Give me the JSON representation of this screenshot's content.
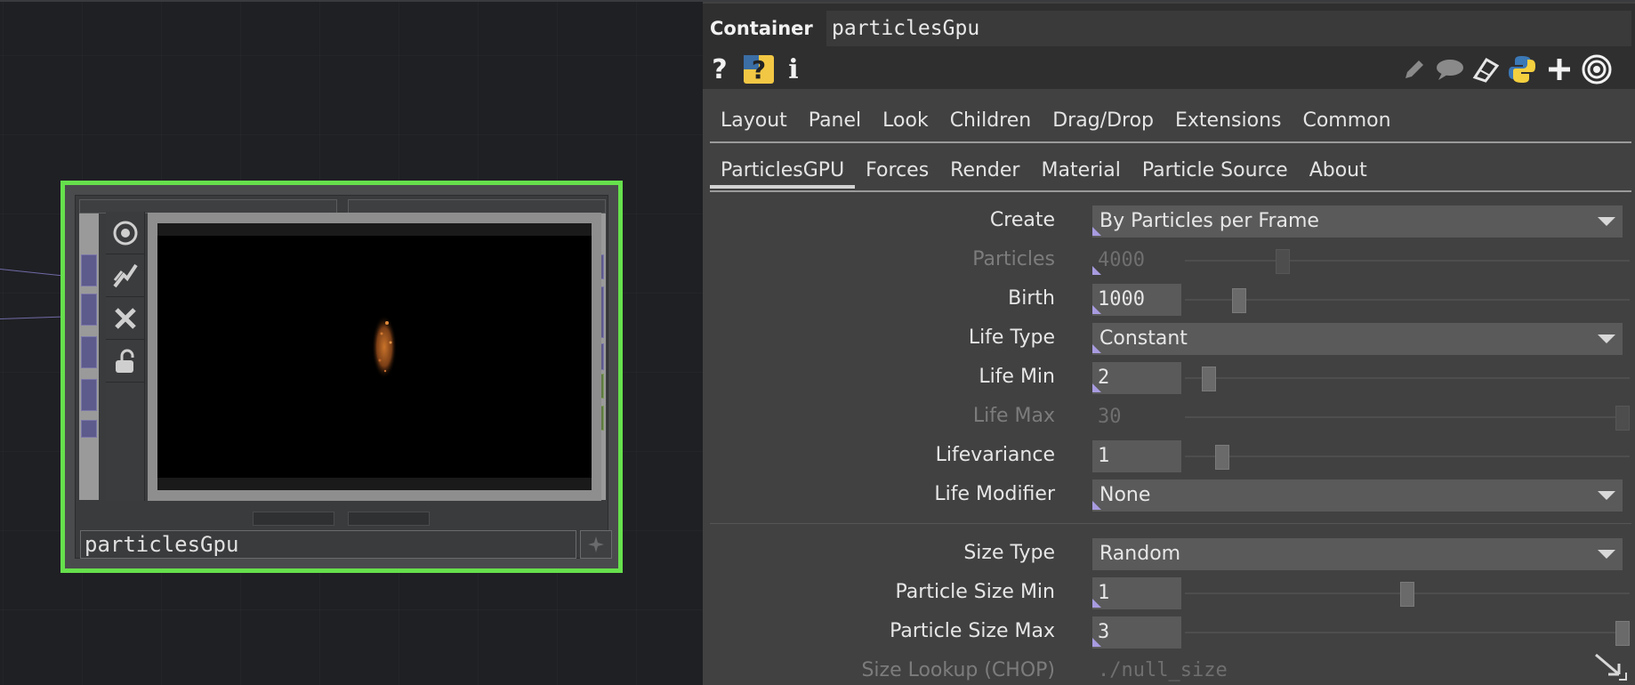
{
  "network": {
    "node": {
      "name": "particlesGpu",
      "tools": [
        "viewer-active-icon",
        "bypass-icon",
        "close-icon",
        "lock-icon"
      ]
    }
  },
  "panel": {
    "op_type": "Container",
    "op_name": "particlesGpu",
    "header_icons": [
      "help-icon",
      "python-help-icon",
      "info-icon",
      "edit-icon",
      "comment-icon",
      "clone-icon",
      "python-icon",
      "add-icon",
      "viewer-icon"
    ],
    "tabs_row1": [
      "Layout",
      "Panel",
      "Look",
      "Children",
      "Drag/Drop",
      "Extensions",
      "Common"
    ],
    "tabs_row2": [
      "ParticlesGPU",
      "Forces",
      "Render",
      "Material",
      "Particle Source",
      "About"
    ],
    "active_tab": "ParticlesGPU",
    "params": {
      "create": {
        "label": "Create",
        "value": "By Particles per Frame"
      },
      "particles": {
        "label": "Particles",
        "value": "4000",
        "slider": 0.21
      },
      "birth": {
        "label": "Birth",
        "value": "1000",
        "slider": 0.11
      },
      "life_type": {
        "label": "Life Type",
        "value": "Constant"
      },
      "life_min": {
        "label": "Life Min",
        "value": "2",
        "slider": 0.04
      },
      "life_max": {
        "label": "Life Max",
        "value": "30",
        "slider": 1.0
      },
      "lifevariance": {
        "label": "Lifevariance",
        "value": "1",
        "slider": 0.07
      },
      "life_modifier": {
        "label": "Life Modifier",
        "value": "None"
      },
      "size_type": {
        "label": "Size Type",
        "value": "Random"
      },
      "particle_size_min": {
        "label": "Particle Size Min",
        "value": "1",
        "slider": 0.5
      },
      "particle_size_max": {
        "label": "Particle Size Max",
        "value": "3",
        "slider": 1.0
      },
      "size_lookup": {
        "label": "Size Lookup (CHOP)",
        "value": "./null_size"
      }
    }
  },
  "colors": {
    "selected_node": "#66e04c",
    "panel_bg": "#414141",
    "field_bg": "#5a5a5a"
  }
}
